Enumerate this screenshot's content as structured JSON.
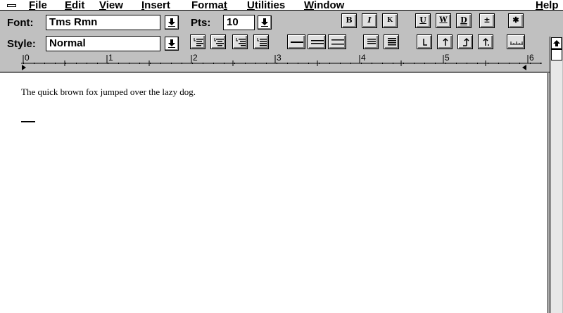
{
  "menu": {
    "items": [
      "File",
      "Edit",
      "View",
      "Insert",
      "Format",
      "Utilities",
      "Window",
      "Help"
    ],
    "underline": [
      "F",
      "E",
      "V",
      "I",
      "t",
      "U",
      "W",
      "H"
    ]
  },
  "toolbar": {
    "font_label": "Font:",
    "font_value": "Tms Rmn",
    "pts_label": "Pts:",
    "pts_value": "10",
    "style_label": "Style:",
    "style_value": "Normal",
    "bold_label": "B",
    "italic_label": "I",
    "smallcaps_label": "K",
    "underline_label": "U",
    "word_underline_label": "W",
    "double_underline_label": "D",
    "superscript_label": "±",
    "show_all_label": "✱"
  },
  "ruler": {
    "numbers": [
      "0",
      "1",
      "2",
      "3",
      "4",
      "5",
      "6"
    ]
  },
  "document": {
    "text": "The quick brown fox jumped over the lazy dog."
  }
}
